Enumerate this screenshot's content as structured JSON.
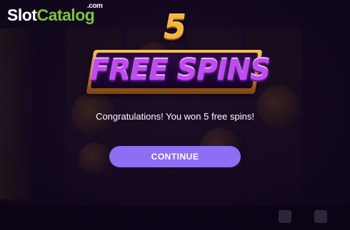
{
  "watermark": {
    "slot": "Slot",
    "catalog": "Catalog",
    "com": ".com"
  },
  "popup": {
    "spin_count": "5",
    "title": "FREE SPINS",
    "message": "Congratulations! You won 5 free spins!",
    "continue_label": "CONTINUE"
  },
  "colors": {
    "button": "#8c6ff2",
    "title_purple": "#c04cf0",
    "gold": "#f3b63c",
    "watermark_green": "#7cc242"
  }
}
